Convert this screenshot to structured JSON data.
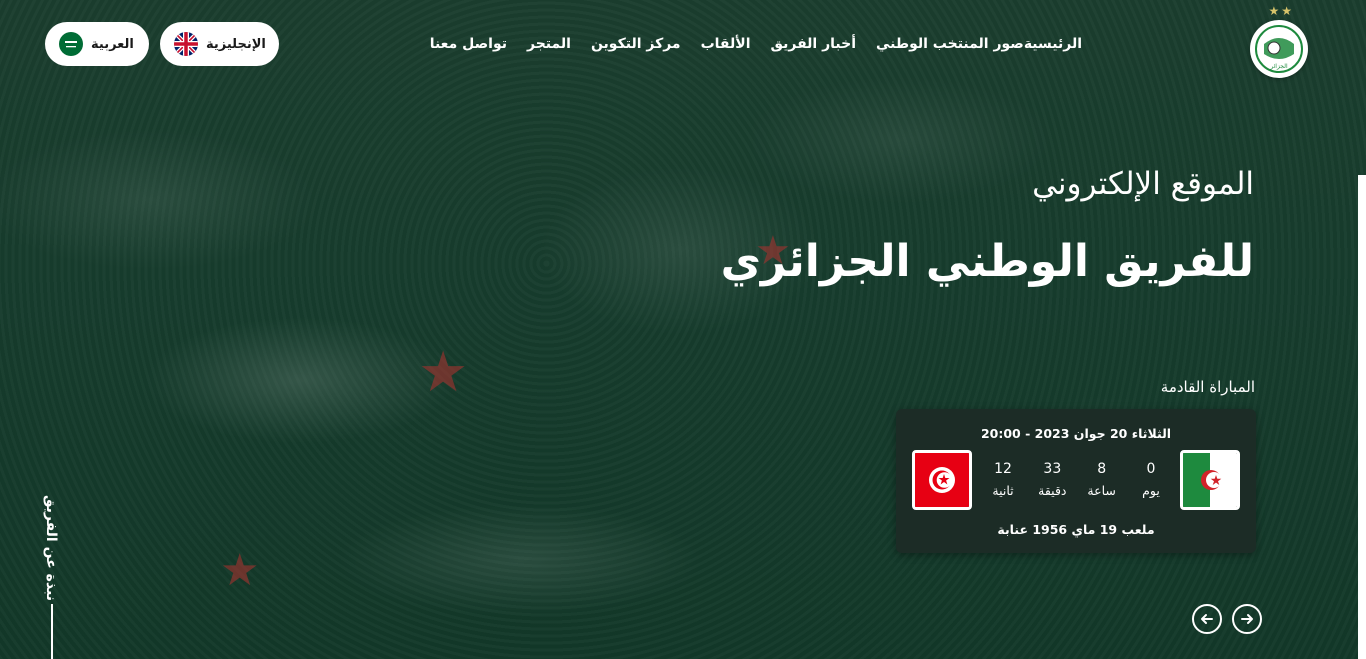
{
  "nav": {
    "items": [
      {
        "label": "الرئيسية"
      },
      {
        "label": "صور المنتخب الوطني"
      },
      {
        "label": "أخبار الفريق"
      },
      {
        "label": "الألقاب"
      },
      {
        "label": "مركز التكوين"
      },
      {
        "label": "المتجر"
      },
      {
        "label": "تواصل معنا"
      }
    ]
  },
  "languages": {
    "english": "الإنجليزية",
    "arabic": "العربية"
  },
  "logo": {
    "stars": "★★",
    "caption": "الجزائر"
  },
  "hero": {
    "line1": "الموقع الإلكتروني",
    "line2": "للفريق الوطني الجزائري"
  },
  "next_match": {
    "label": "المباراة القادمة",
    "date": "الثلاثاء 20 جوان 2023 - 20:00",
    "venue": "ملعب 19 ماي 1956 عنابة",
    "home_team": "algeria",
    "away_team": "tunisia",
    "countdown": [
      {
        "value": "0",
        "unit": "يوم"
      },
      {
        "value": "8",
        "unit": "ساعة"
      },
      {
        "value": "33",
        "unit": "دقيقة"
      },
      {
        "value": "12",
        "unit": "ثانية"
      }
    ]
  },
  "side_link": "نبذة عن الفريق",
  "colors": {
    "overlay": "#0e3424",
    "card": "#1c2c26",
    "algeria_green": "#1e8a3e",
    "tunisia_red": "#e70013"
  }
}
